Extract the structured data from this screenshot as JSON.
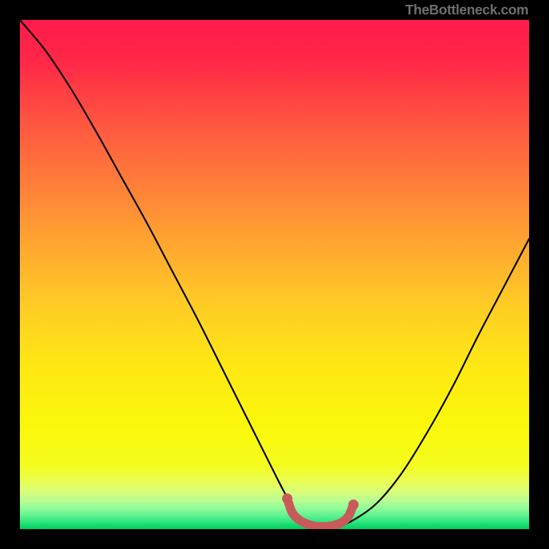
{
  "watermark": "TheBottleneck.com",
  "gradient": {
    "stops": [
      {
        "offset": 0.0,
        "color": "#ff1a4a"
      },
      {
        "offset": 0.09,
        "color": "#ff2a47"
      },
      {
        "offset": 0.2,
        "color": "#ff5540"
      },
      {
        "offset": 0.32,
        "color": "#ff7d3a"
      },
      {
        "offset": 0.44,
        "color": "#ffa630"
      },
      {
        "offset": 0.56,
        "color": "#ffcc25"
      },
      {
        "offset": 0.68,
        "color": "#fee813"
      },
      {
        "offset": 0.8,
        "color": "#faf80a"
      },
      {
        "offset": 0.875,
        "color": "#f4fd1e"
      },
      {
        "offset": 0.905,
        "color": "#eafd52"
      },
      {
        "offset": 0.926,
        "color": "#d8fe78"
      },
      {
        "offset": 0.944,
        "color": "#b9fd92"
      },
      {
        "offset": 0.96,
        "color": "#8dfb98"
      },
      {
        "offset": 0.974,
        "color": "#5ef28f"
      },
      {
        "offset": 0.985,
        "color": "#32e67e"
      },
      {
        "offset": 0.993,
        "color": "#12da6d"
      },
      {
        "offset": 1.0,
        "color": "#00d060"
      }
    ]
  },
  "chart_data": {
    "type": "line",
    "title": "",
    "xlabel": "",
    "ylabel": "",
    "xlim": [
      0,
      100
    ],
    "ylim": [
      0,
      100
    ],
    "series": [
      {
        "name": "bottleneck-curve",
        "x": [
          0,
          5,
          10,
          15,
          20,
          25,
          30,
          35,
          40,
          45,
          50,
          52.5,
          55,
          57,
          59,
          62,
          65,
          70,
          75,
          80,
          85,
          90,
          95,
          100
        ],
        "y": [
          100,
          94,
          86.5,
          78,
          69,
          60,
          50.5,
          41,
          31,
          21,
          11,
          6.2,
          2.3,
          0.7,
          0.5,
          0.6,
          1.5,
          5,
          11,
          19,
          28,
          38,
          47.5,
          57
        ]
      }
    ],
    "highlight": {
      "name": "sweet-spot",
      "x": [
        52.5,
        53.5,
        55,
        57,
        59,
        61,
        63,
        64.5,
        65.5
      ],
      "y": [
        6.0,
        3.2,
        1.7,
        0.8,
        0.5,
        0.6,
        1.2,
        2.5,
        4.8
      ]
    }
  }
}
